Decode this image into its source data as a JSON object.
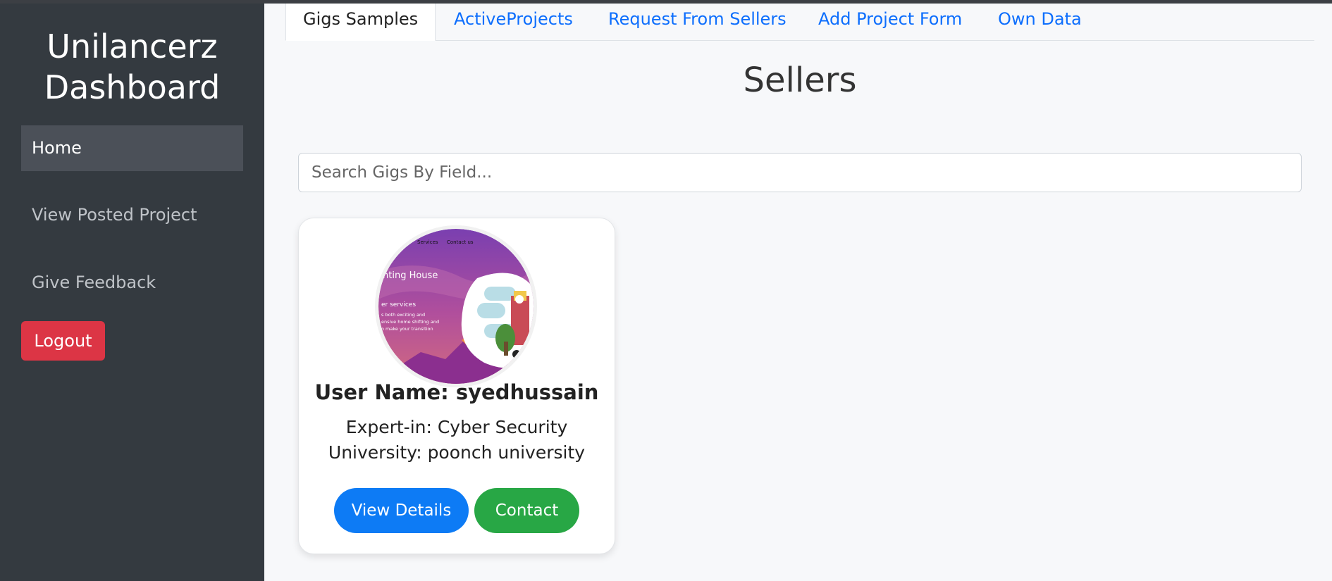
{
  "sidebar": {
    "brand_line1": "Unilancerz",
    "brand_line2": "Dashboard",
    "items": [
      {
        "label": "Home"
      },
      {
        "label": "View Posted Project"
      },
      {
        "label": "Give Feedback"
      }
    ],
    "logout_label": "Logout"
  },
  "tabs": [
    {
      "label": "Gigs Samples"
    },
    {
      "label": "ActiveProjects"
    },
    {
      "label": "Request From Sellers"
    },
    {
      "label": "Add Project Form"
    },
    {
      "label": "Own Data"
    }
  ],
  "main": {
    "title": "Sellers",
    "search_placeholder": "Search Gigs By Field..."
  },
  "card": {
    "avatar_text": {
      "nav1": "Services",
      "nav2": "Contact us",
      "heading": "nting House",
      "sub": "er services",
      "body1": "s both exciting and",
      "body2": "ensive home shifting and",
      "body3": "o make your transition"
    },
    "title": "User Name: syedhussain",
    "expert": "Expert-in: Cyber Security",
    "university": "University: poonch university",
    "view_label": "View Details",
    "contact_label": "Contact"
  },
  "colors": {
    "sidebar": "#343a40",
    "logout": "#dc3545",
    "primary": "#0d7bf5",
    "success": "#28a745",
    "link": "#0d6efd"
  }
}
